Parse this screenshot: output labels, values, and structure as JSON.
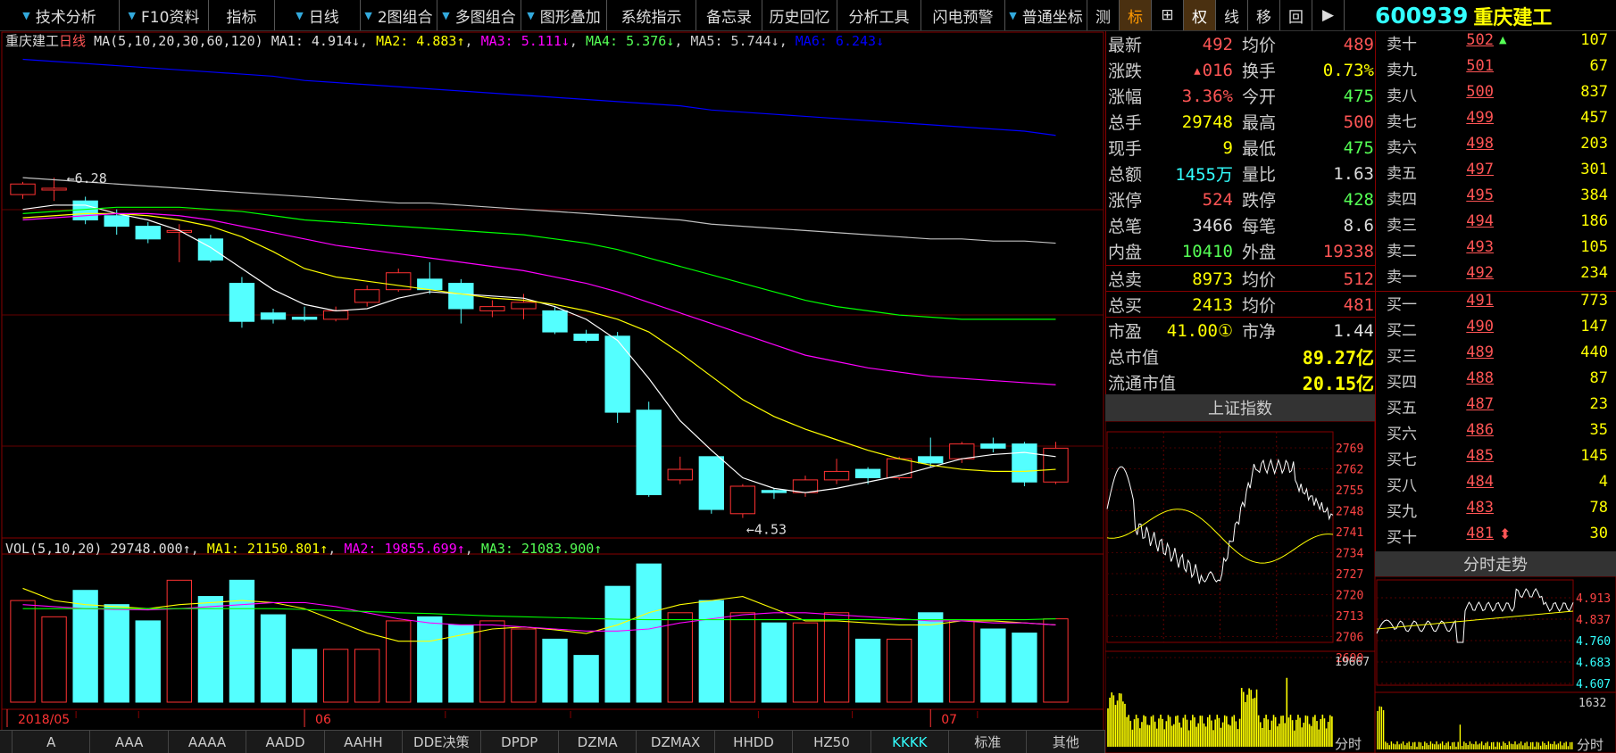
{
  "toolbar": {
    "items": [
      "技术分析",
      "F10资料",
      "指标",
      "日线",
      "2图组合",
      "多图组合",
      "图形叠加",
      "系统指示",
      "备忘录",
      "历史回忆",
      "分析工具",
      "闪电预警",
      "普通坐标"
    ],
    "right_tools": [
      "测",
      "标",
      "⊞",
      "权",
      "线",
      "移",
      "回",
      "▶"
    ]
  },
  "stock": {
    "code": "600939",
    "name": "重庆建工"
  },
  "chart": {
    "title": "重庆建工",
    "period": "日线",
    "ma_label": "MA(5,10,20,30,60,120)",
    "ma1": "MA1: 4.914↓",
    "ma2": "MA2: 4.883↑",
    "ma3": "MA3: 5.111↓",
    "ma4": "MA4: 5.376↓",
    "ma5": "MA5: 5.744↓",
    "ma6": "MA6: 6.243↓",
    "high_label": "6.28",
    "low_label": "4.53",
    "vol_label": "VOL(5,10,20)",
    "vol_value": "29748.000↑",
    "vol_ma1": "MA1: 21150.801↑",
    "vol_ma2": "MA2: 19855.699↑",
    "vol_ma3": "MA3: 21083.900↑",
    "dates": [
      "2018/05",
      "06",
      "07"
    ],
    "colors": {
      "up": "#ff3232",
      "down": "#54ffff",
      "ma1": "#ffffff",
      "ma2": "#ffff00",
      "ma3": "#ff00ff",
      "ma4": "#00ff00",
      "ma5": "#c0c0c0",
      "ma6": "#0000ff"
    }
  },
  "chart_data": {
    "type": "candlestick",
    "candles": [
      {
        "o": 5.97,
        "c": 6.02,
        "h": 6.03,
        "l": 5.95
      },
      {
        "o": 6.0,
        "c": 6.0,
        "h": 6.05,
        "l": 5.94
      },
      {
        "o": 5.94,
        "c": 5.85,
        "h": 5.96,
        "l": 5.83
      },
      {
        "o": 5.87,
        "c": 5.82,
        "h": 5.9,
        "l": 5.78
      },
      {
        "o": 5.82,
        "c": 5.76,
        "h": 5.84,
        "l": 5.74
      },
      {
        "o": 5.8,
        "c": 5.8,
        "h": 5.83,
        "l": 5.65
      },
      {
        "o": 5.76,
        "c": 5.66,
        "h": 5.78,
        "l": 5.65
      },
      {
        "o": 5.55,
        "c": 5.37,
        "h": 5.58,
        "l": 5.34
      },
      {
        "o": 5.41,
        "c": 5.38,
        "h": 5.43,
        "l": 5.36
      },
      {
        "o": 5.39,
        "c": 5.38,
        "h": 5.44,
        "l": 5.37
      },
      {
        "o": 5.38,
        "c": 5.42,
        "h": 5.44,
        "l": 5.37
      },
      {
        "o": 5.46,
        "c": 5.52,
        "h": 5.54,
        "l": 5.44
      },
      {
        "o": 5.52,
        "c": 5.6,
        "h": 5.62,
        "l": 5.51
      },
      {
        "o": 5.57,
        "c": 5.52,
        "h": 5.65,
        "l": 5.5
      },
      {
        "o": 5.55,
        "c": 5.43,
        "h": 5.57,
        "l": 5.36
      },
      {
        "o": 5.42,
        "c": 5.44,
        "h": 5.47,
        "l": 5.39
      },
      {
        "o": 5.43,
        "c": 5.46,
        "h": 5.5,
        "l": 5.38
      },
      {
        "o": 5.42,
        "c": 5.32,
        "h": 5.44,
        "l": 5.31
      },
      {
        "o": 5.31,
        "c": 5.28,
        "h": 5.33,
        "l": 5.27
      },
      {
        "o": 5.3,
        "c": 4.94,
        "h": 5.32,
        "l": 4.89
      },
      {
        "o": 4.95,
        "c": 4.55,
        "h": 4.99,
        "l": 4.54
      },
      {
        "o": 4.62,
        "c": 4.67,
        "h": 4.73,
        "l": 4.6
      },
      {
        "o": 4.73,
        "c": 4.48,
        "h": 4.73,
        "l": 4.46
      },
      {
        "o": 4.46,
        "c": 4.59,
        "h": 4.6,
        "l": 4.44
      },
      {
        "o": 4.57,
        "c": 4.56,
        "h": 4.58,
        "l": 4.53
      },
      {
        "o": 4.56,
        "c": 4.62,
        "h": 4.64,
        "l": 4.54
      },
      {
        "o": 4.62,
        "c": 4.66,
        "h": 4.72,
        "l": 4.6
      },
      {
        "o": 4.67,
        "c": 4.63,
        "h": 4.68,
        "l": 4.6
      },
      {
        "o": 4.63,
        "c": 4.72,
        "h": 4.73,
        "l": 4.62
      },
      {
        "o": 4.73,
        "c": 4.7,
        "h": 4.82,
        "l": 4.68
      },
      {
        "o": 4.72,
        "c": 4.79,
        "h": 4.8,
        "l": 4.7
      },
      {
        "o": 4.79,
        "c": 4.77,
        "h": 4.82,
        "l": 4.75
      },
      {
        "o": 4.79,
        "c": 4.61,
        "h": 4.8,
        "l": 4.59
      },
      {
        "o": 4.61,
        "c": 4.77,
        "h": 4.8,
        "l": 4.6
      }
    ],
    "volumes": [
      25000,
      21000,
      27500,
      24000,
      20000,
      30000,
      26000,
      30000,
      21500,
      13000,
      13000,
      13000,
      20000,
      21000,
      19000,
      20000,
      18000,
      15500,
      11500,
      28500,
      34000,
      22000,
      25000,
      22000,
      19500,
      19500,
      22000,
      15500,
      15500,
      22000,
      20000,
      18000,
      17000,
      20500
    ],
    "ma": {
      "ma5": [
        5.9,
        5.92,
        5.92,
        5.88,
        5.85,
        5.8,
        5.72,
        5.62,
        5.52,
        5.45,
        5.42,
        5.43,
        5.48,
        5.51,
        5.5,
        5.49,
        5.48,
        5.44,
        5.38,
        5.28,
        5.1,
        4.9,
        4.76,
        4.63,
        4.58,
        4.56,
        4.58,
        4.61,
        4.64,
        4.68,
        4.72,
        4.74,
        4.75,
        4.73
      ],
      "ma10": [
        5.86,
        5.87,
        5.88,
        5.88,
        5.87,
        5.85,
        5.82,
        5.77,
        5.7,
        5.62,
        5.58,
        5.56,
        5.54,
        5.52,
        5.5,
        5.48,
        5.47,
        5.45,
        5.42,
        5.38,
        5.32,
        5.22,
        5.11,
        5.0,
        4.92,
        4.86,
        4.81,
        4.76,
        4.72,
        4.69,
        4.67,
        4.66,
        4.66,
        4.67
      ],
      "ma20": [
        5.85,
        5.86,
        5.87,
        5.88,
        5.88,
        5.87,
        5.85,
        5.82,
        5.79,
        5.76,
        5.73,
        5.71,
        5.69,
        5.67,
        5.65,
        5.63,
        5.61,
        5.58,
        5.55,
        5.51,
        5.46,
        5.41,
        5.36,
        5.31,
        5.26,
        5.21,
        5.18,
        5.15,
        5.13,
        5.11,
        5.1,
        5.09,
        5.08,
        5.07
      ],
      "ma30": [
        5.88,
        5.89,
        5.9,
        5.91,
        5.91,
        5.91,
        5.9,
        5.89,
        5.87,
        5.85,
        5.84,
        5.83,
        5.82,
        5.81,
        5.8,
        5.79,
        5.78,
        5.76,
        5.74,
        5.71,
        5.67,
        5.63,
        5.59,
        5.55,
        5.51,
        5.47,
        5.44,
        5.42,
        5.4,
        5.39,
        5.38,
        5.38,
        5.38,
        5.38
      ],
      "ma60": [
        6.05,
        6.04,
        6.03,
        6.02,
        6.01,
        6.0,
        5.99,
        5.98,
        5.97,
        5.96,
        5.95,
        5.94,
        5.93,
        5.93,
        5.92,
        5.91,
        5.9,
        5.89,
        5.88,
        5.87,
        5.86,
        5.85,
        5.83,
        5.82,
        5.81,
        5.8,
        5.79,
        5.78,
        5.77,
        5.76,
        5.76,
        5.75,
        5.75,
        5.74
      ],
      "ma120": [
        6.61,
        6.6,
        6.59,
        6.58,
        6.57,
        6.56,
        6.55,
        6.54,
        6.53,
        6.51,
        6.5,
        6.49,
        6.48,
        6.47,
        6.46,
        6.45,
        6.44,
        6.43,
        6.42,
        6.41,
        6.4,
        6.39,
        6.37,
        6.36,
        6.35,
        6.34,
        6.33,
        6.32,
        6.31,
        6.3,
        6.29,
        6.28,
        6.27,
        6.25
      ]
    },
    "vol_ma": {
      "ma5": [
        28000,
        25000,
        24000,
        23500,
        23000,
        24000,
        24500,
        25000,
        24500,
        23000,
        20000,
        17000,
        15000,
        15000,
        16500,
        18000,
        18500,
        17800,
        16900,
        19000,
        22000,
        24000,
        25000,
        26000,
        23000,
        20000,
        20000,
        19500,
        19000,
        19000,
        20000,
        20000,
        19500,
        19000
      ],
      "ma10": [
        24000,
        23500,
        23000,
        22800,
        22700,
        23000,
        23500,
        24000,
        24500,
        24500,
        23500,
        22000,
        20500,
        19500,
        19000,
        19000,
        18500,
        18000,
        17500,
        17500,
        18000,
        19500,
        20500,
        21500,
        22000,
        22000,
        21500,
        21000,
        20500,
        20000,
        20000,
        19500,
        19500,
        19000
      ],
      "ma20": [
        23000,
        23000,
        23000,
        23000,
        23000,
        23000,
        23000,
        23000,
        23000,
        22800,
        22500,
        22300,
        22000,
        21800,
        21500,
        21200,
        21000,
        20800,
        20600,
        20400,
        20300,
        20300,
        20300,
        20300,
        20300,
        20300,
        20300,
        20300,
        20300,
        20300,
        20300,
        20300,
        20300,
        20500
      ]
    }
  },
  "quote": {
    "rows": [
      {
        "l1": "最新",
        "v1": "492",
        "c1": "red",
        "l2": "均价",
        "v2": "489",
        "c2": "red"
      },
      {
        "l1": "涨跌",
        "v1": "▴016",
        "c1": "red",
        "l2": "换手",
        "v2": "0.73%",
        "c2": "yel"
      },
      {
        "l1": "涨幅",
        "v1": "3.36%",
        "c1": "red",
        "l2": "今开",
        "v2": "475",
        "c2": "grn"
      },
      {
        "l1": "总手",
        "v1": "29748",
        "c1": "yel",
        "l2": "最高",
        "v2": "500",
        "c2": "red"
      },
      {
        "l1": "现手",
        "v1": "9",
        "c1": "yel",
        "l2": "最低",
        "v2": "475",
        "c2": "grn"
      },
      {
        "l1": "总额",
        "v1": "1455万",
        "c1": "cyn",
        "l2": "量比",
        "v2": "1.63",
        "c2": "wht"
      },
      {
        "l1": "涨停",
        "v1": "524",
        "c1": "red",
        "l2": "跌停",
        "v2": "428",
        "c2": "grn"
      },
      {
        "l1": "总笔",
        "v1": "3466",
        "c1": "wht",
        "l2": "每笔",
        "v2": "8.6",
        "c2": "wht"
      },
      {
        "l1": "内盘",
        "v1": "10410",
        "c1": "grn",
        "l2": "外盘",
        "v2": "19338",
        "c2": "red"
      }
    ],
    "sell_total": {
      "l1": "总卖",
      "v1": "8973",
      "l2": "均价",
      "v2": "512"
    },
    "buy_total": {
      "l1": "总买",
      "v1": "2413",
      "l2": "均价",
      "v2": "481"
    },
    "pe": {
      "l1": "市盈",
      "v1": "41.00①",
      "l2": "市净",
      "v2": "1.44"
    },
    "mcap": {
      "label": "总市值",
      "value": "89.27亿"
    },
    "float_mcap": {
      "label": "流通市值",
      "value": "20.15亿"
    }
  },
  "index": {
    "title": "上证指数",
    "scale": [
      "2769",
      "2762",
      "2755",
      "2748",
      "2741",
      "2734",
      "2727",
      "2720",
      "2713",
      "2706",
      "2699"
    ],
    "vol_max": "19667",
    "footer": "分时"
  },
  "orderbook": {
    "sell": [
      {
        "label": "卖十",
        "price": "502",
        "vol": "107"
      },
      {
        "label": "卖九",
        "price": "501",
        "vol": "67"
      },
      {
        "label": "卖八",
        "price": "500",
        "vol": "837"
      },
      {
        "label": "卖七",
        "price": "499",
        "vol": "457"
      },
      {
        "label": "卖六",
        "price": "498",
        "vol": "203"
      },
      {
        "label": "卖五",
        "price": "497",
        "vol": "301"
      },
      {
        "label": "卖四",
        "price": "495",
        "vol": "384"
      },
      {
        "label": "卖三",
        "price": "494",
        "vol": "186"
      },
      {
        "label": "卖二",
        "price": "493",
        "vol": "105"
      },
      {
        "label": "卖一",
        "price": "492",
        "vol": "234"
      }
    ],
    "buy": [
      {
        "label": "买一",
        "price": "491",
        "vol": "773"
      },
      {
        "label": "买二",
        "price": "490",
        "vol": "147"
      },
      {
        "label": "买三",
        "price": "489",
        "vol": "440"
      },
      {
        "label": "买四",
        "price": "488",
        "vol": "87"
      },
      {
        "label": "买五",
        "price": "487",
        "vol": "23"
      },
      {
        "label": "买六",
        "price": "486",
        "vol": "35"
      },
      {
        "label": "买七",
        "price": "485",
        "vol": "145"
      },
      {
        "label": "买八",
        "price": "484",
        "vol": "4"
      },
      {
        "label": "买九",
        "price": "483",
        "vol": "78"
      },
      {
        "label": "买十",
        "price": "481",
        "vol": "30"
      }
    ]
  },
  "timeshare": {
    "title": "分时走势",
    "scale": [
      "4.913",
      "4.837",
      "4.760",
      "4.683",
      "4.607"
    ],
    "vol_max": "1632",
    "footer": "分时"
  },
  "bottom_tabs": [
    "A",
    "AAA",
    "AAAA",
    "AADD",
    "AAHH",
    "DDE决策",
    "DPDP",
    "DZMA",
    "DZMAX",
    "HHDD",
    "HZ50",
    "KKKK",
    "标准",
    "其他"
  ],
  "active_bottom_tab": "KKKK"
}
